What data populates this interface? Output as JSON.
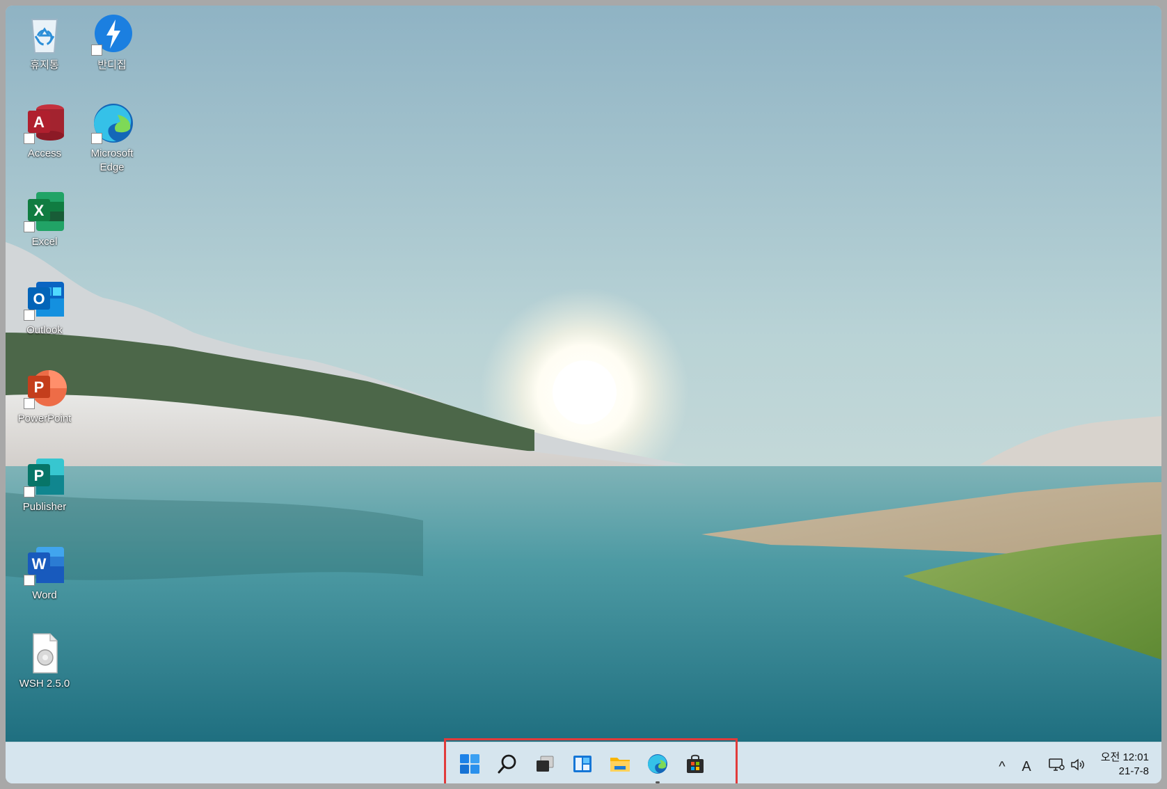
{
  "desktop_icons": [
    {
      "label": "휴지통"
    },
    {
      "label": "반디집"
    },
    {
      "label": "Access"
    },
    {
      "label": "Microsoft\nEdge"
    },
    {
      "label": "Excel"
    },
    {
      "label": "Outlook"
    },
    {
      "label": "PowerPoint"
    },
    {
      "label": "Publisher"
    },
    {
      "label": "Word"
    },
    {
      "label": "WSH 2.5.0"
    }
  ],
  "taskbar": {
    "pinned": [
      "start-icon",
      "search-icon",
      "task-view-icon",
      "widgets-icon",
      "file-explorer-icon",
      "edge-icon",
      "store-icon"
    ],
    "tray": {
      "chevron": "^",
      "ime": "A"
    },
    "clock": {
      "time": "오전 12:01",
      "date": "21-7-8"
    }
  },
  "colors": {
    "highlight": "#e13b3b",
    "taskbar": "#d6e5ee"
  }
}
